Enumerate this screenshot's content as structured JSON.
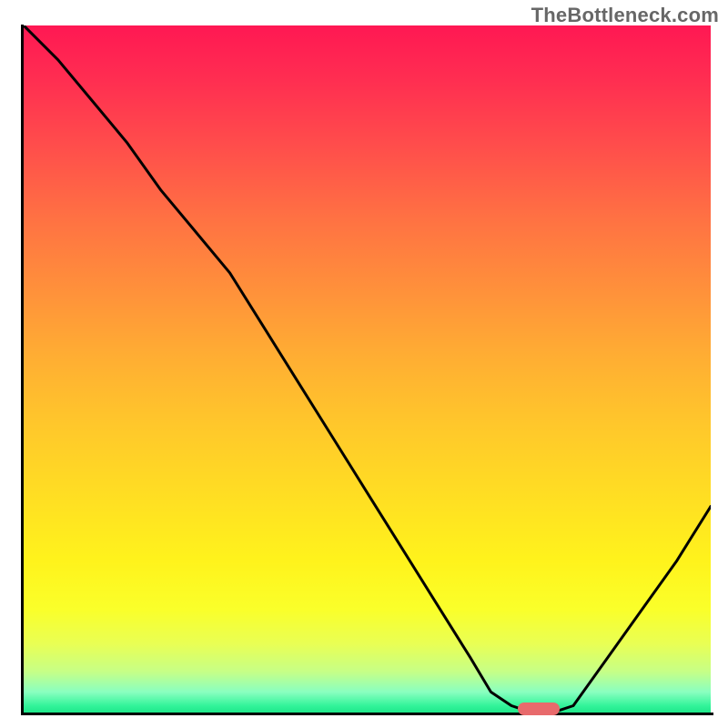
{
  "watermark": "TheBottleneck.com",
  "chart_data": {
    "type": "line",
    "title": "",
    "xlabel": "",
    "ylabel": "",
    "xlim": [
      0,
      100
    ],
    "ylim": [
      0,
      100
    ],
    "x": [
      0,
      5,
      10,
      15,
      20,
      25,
      30,
      35,
      40,
      45,
      50,
      55,
      60,
      65,
      68,
      71,
      74,
      77,
      80,
      85,
      90,
      95,
      100
    ],
    "y": [
      100,
      95,
      89,
      83,
      76,
      70,
      64,
      56,
      48,
      40,
      32,
      24,
      16,
      8,
      3,
      1,
      0,
      0,
      1,
      8,
      15,
      22,
      30
    ],
    "optimum_marker": {
      "x": 75,
      "y": 0
    },
    "background_gradient": {
      "top": "#ff1853",
      "mid": "#ffdd23",
      "bottom": "#1ee78a"
    }
  }
}
